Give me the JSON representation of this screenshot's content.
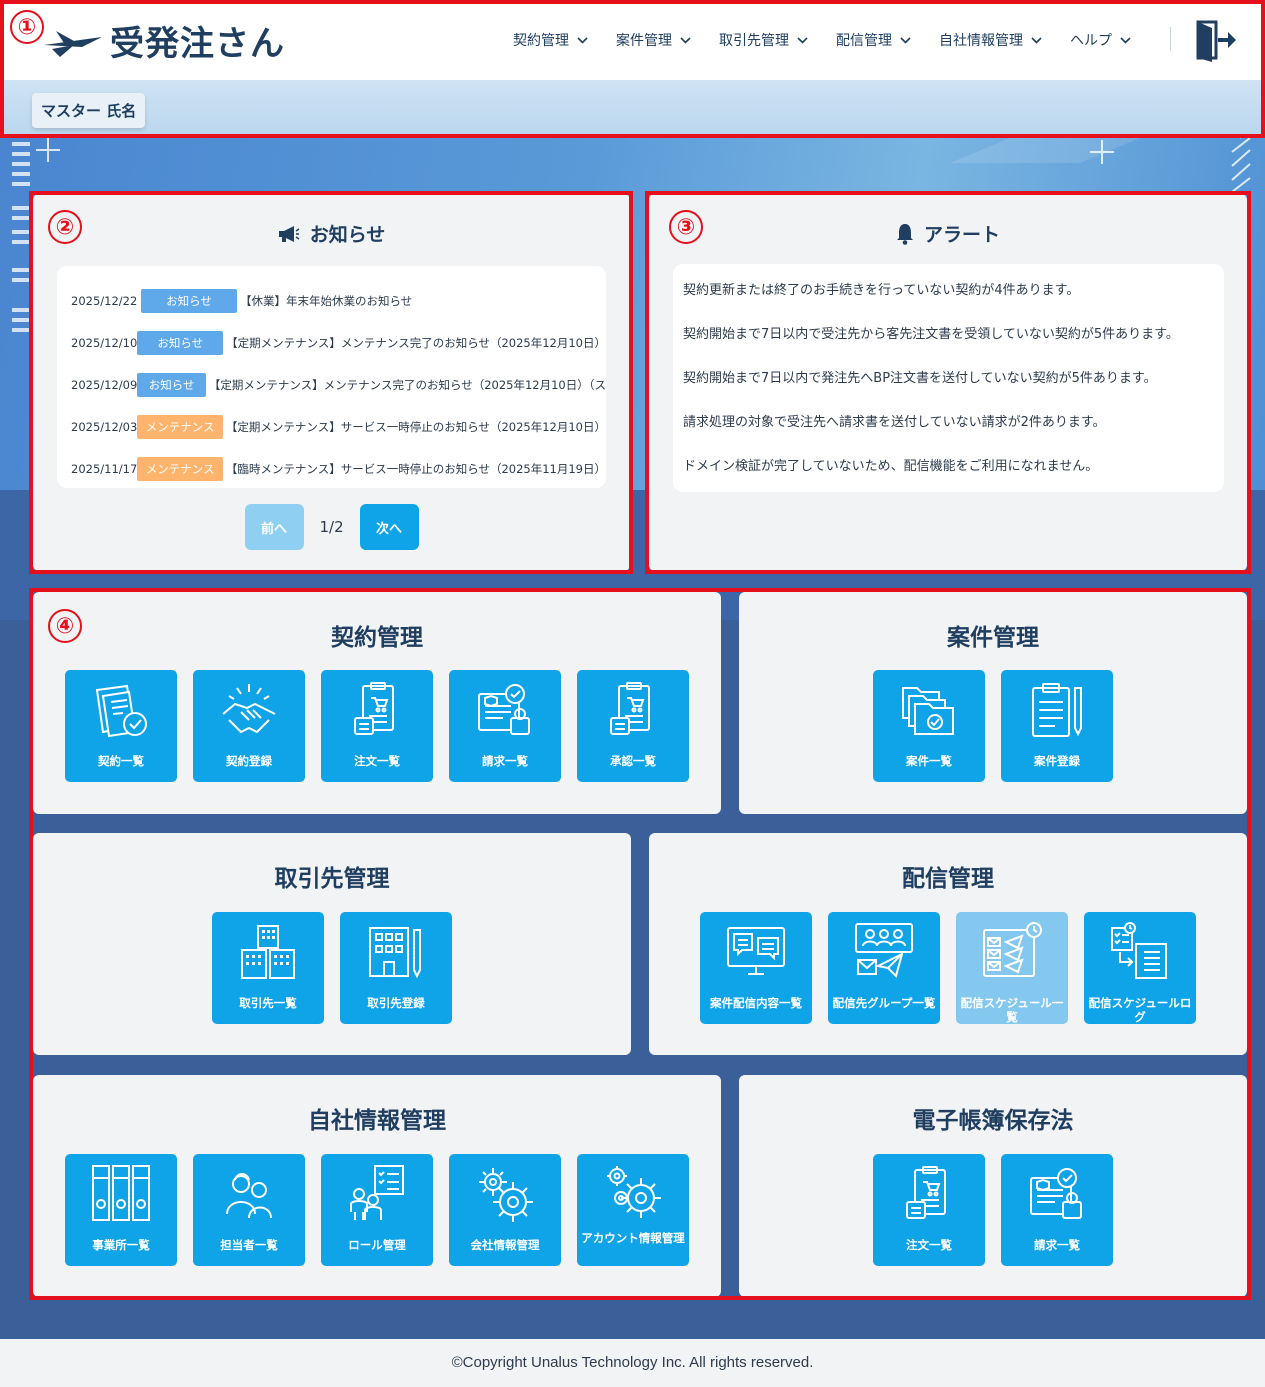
{
  "header": {
    "logo_text": "受発注さん",
    "nav": [
      {
        "label": "契約管理"
      },
      {
        "label": "案件管理"
      },
      {
        "label": "取引先管理"
      },
      {
        "label": "配信管理"
      },
      {
        "label": "自社情報管理"
      },
      {
        "label": "ヘルプ"
      }
    ],
    "user_name": "マスター 氏名"
  },
  "markers": [
    "①",
    "②",
    "③",
    "④"
  ],
  "notices": {
    "title": "お知らせ",
    "items": [
      {
        "date": "2025/12/22",
        "category": "お知らせ",
        "title": "【休業】年末年始休業のお知らせ"
      },
      {
        "date": "2025/12/10",
        "category": "お知らせ",
        "title": "【定期メンテナンス】メンテナンス完了のお知らせ（2025年12月10日）"
      },
      {
        "date": "2025/12/09",
        "category": "お知らせ",
        "title": "【定期メンテナンス】メンテナンス完了のお知らせ（2025年12月10日）（ス"
      },
      {
        "date": "2025/12/03",
        "category": "メンテナンス",
        "title": "【定期メンテナンス】サービス一時停止のお知らせ（2025年12月10日）"
      },
      {
        "date": "2025/11/17",
        "category": "メンテナンス",
        "title": "【臨時メンテナンス】サービス一時停止のお知らせ（2025年11月19日）"
      }
    ],
    "prev_label": "前へ",
    "next_label": "次へ",
    "page_indicator": "1/2"
  },
  "alerts": {
    "title": "アラート",
    "items": [
      "契約更新または終了のお手続きを行っていない契約が4件あります。",
      "契約開始まで7日以内で受注先から客先注文書を受領していない契約が5件あります。",
      "契約開始まで7日以内で発注先へBP注文書を送付していない契約が5件あります。",
      "請求処理の対象で受注先へ請求書を送付していない請求が2件あります。",
      "ドメイン検証が完了していないため、配信機能をご利用になれません。"
    ]
  },
  "sections": {
    "contract": {
      "title": "契約管理",
      "tiles": [
        {
          "label": "契約一覧",
          "icon": "contract-list-icon"
        },
        {
          "label": "契約登録",
          "icon": "handshake-icon"
        },
        {
          "label": "注文一覧",
          "icon": "order-list-icon"
        },
        {
          "label": "請求一覧",
          "icon": "invoice-list-icon"
        },
        {
          "label": "承認一覧",
          "icon": "approval-list-icon"
        }
      ]
    },
    "project": {
      "title": "案件管理",
      "tiles": [
        {
          "label": "案件一覧",
          "icon": "folders-icon"
        },
        {
          "label": "案件登録",
          "icon": "clipboard-pen-icon"
        }
      ]
    },
    "partner": {
      "title": "取引先管理",
      "tiles": [
        {
          "label": "取引先一覧",
          "icon": "buildings-icon"
        },
        {
          "label": "取引先登録",
          "icon": "building-pen-icon"
        }
      ]
    },
    "delivery": {
      "title": "配信管理",
      "tiles": [
        {
          "label": "案件配信内容一覧",
          "icon": "monitor-chat-icon",
          "disabled": false
        },
        {
          "label": "配信先グループ一覧",
          "icon": "group-mail-icon",
          "disabled": false
        },
        {
          "label": "配信スケジュール一覧",
          "icon": "schedule-mail-icon",
          "disabled": true
        },
        {
          "label": "配信スケジュールログ",
          "icon": "schedule-log-icon",
          "disabled": false
        }
      ]
    },
    "company": {
      "title": "自社情報管理",
      "tiles": [
        {
          "label": "事業所一覧",
          "icon": "binders-icon"
        },
        {
          "label": "担当者一覧",
          "icon": "people-icon"
        },
        {
          "label": "ロール管理",
          "icon": "role-checklist-icon"
        },
        {
          "label": "会社情報管理",
          "icon": "gears-icon"
        },
        {
          "label": "アカウント情報管理",
          "icon": "account-gears-icon"
        }
      ]
    },
    "ebook": {
      "title": "電子帳簿保存法",
      "tiles": [
        {
          "label": "注文一覧",
          "icon": "order-list-icon"
        },
        {
          "label": "請求一覧",
          "icon": "invoice-list-icon"
        }
      ]
    }
  },
  "footer": {
    "copyright": "©Copyright Unalus Technology Inc. All rights reserved."
  },
  "colors": {
    "accent": "#0fa3e8",
    "accent_disabled": "#85c8ef",
    "badge_notice": "#5fa8ea",
    "badge_maintenance": "#ffb46e",
    "prev_disabled": "#8fd0f2",
    "annotation_red": "#e5101c"
  }
}
